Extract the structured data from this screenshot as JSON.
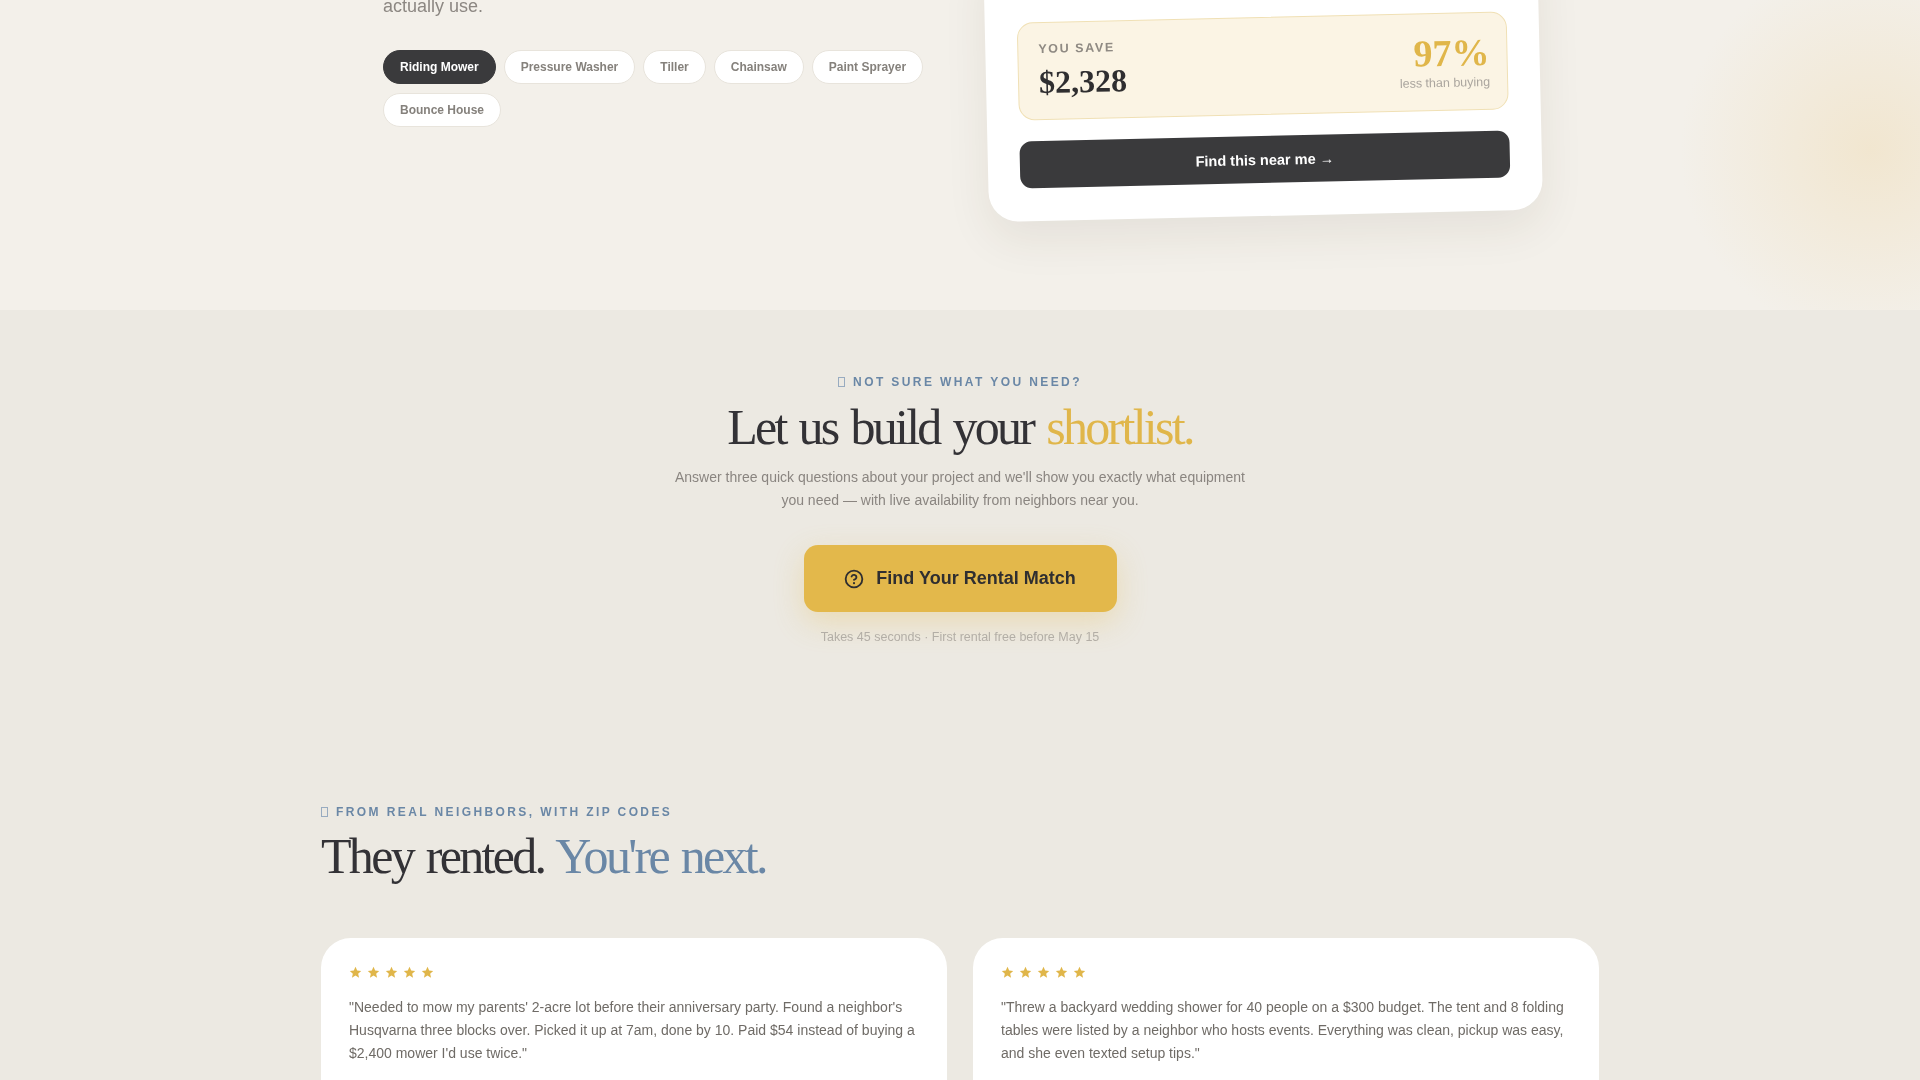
{
  "hero": {
    "intro_tail": "actually use.",
    "equipment_chips": [
      {
        "label": "Riding Mower",
        "selected": true
      },
      {
        "label": "Pressure Washer",
        "selected": false
      },
      {
        "label": "Tiller",
        "selected": false
      },
      {
        "label": "Chainsaw",
        "selected": false
      },
      {
        "label": "Paint Sprayer",
        "selected": false
      },
      {
        "label": "Bounce House",
        "selected": false
      }
    ]
  },
  "savings_card": {
    "label": "YOU SAVE",
    "amount": "$2,328",
    "percent": "97%",
    "percent_note": "less than buying",
    "button": "Find this near me →"
  },
  "quiz_cta": {
    "eyebrow": "NOT SURE WHAT YOU NEED?",
    "heading": "Let us build your",
    "heading_accent": "shortlist.",
    "description": "Answer three quick questions about your project and we'll show you exactly what equipment you need — with live availability from neighbors near you.",
    "button": "Find Your Rental Match",
    "note": "Takes 45 seconds · First rental free before May 15"
  },
  "testimonials": {
    "eyebrow": "FROM REAL NEIGHBORS, WITH ZIP CODES",
    "heading": "They rented.",
    "heading_accent": "You're next.",
    "items": [
      {
        "stars": 5,
        "quote": "\"Needed to mow my parents' 2-acre lot before their anniversary party. Found a neighbor's Husqvarna three blocks over. Picked it up at 7am, done by 10. Paid $54 instead of buying a $2,400 mower I'd use twice.\""
      },
      {
        "stars": 5,
        "quote": "\"Threw a backyard wedding shower for 40 people on a $300 budget. The tent and 8 folding tables were listed by a neighbor who hosts events. Everything was clean, pickup was easy, and she even texted setup tips.\""
      }
    ]
  }
}
